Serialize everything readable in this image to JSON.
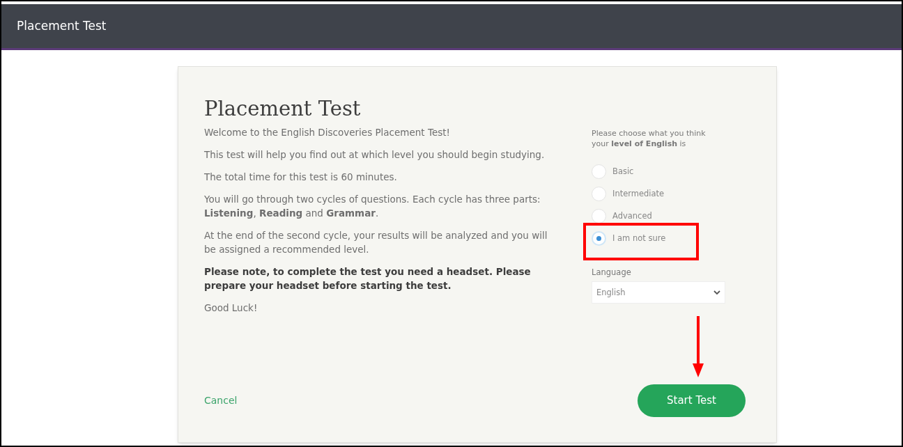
{
  "header": {
    "title": "Placement Test"
  },
  "card": {
    "title": "Placement Test",
    "paragraphs": [
      {
        "kind": "text",
        "text": "Welcome to the English Discoveries Placement Test!"
      },
      {
        "kind": "text",
        "text": "This test will help you find out at which level you should begin studying."
      },
      {
        "kind": "text",
        "text": "The total time for this test is 60 minutes."
      },
      {
        "kind": "text",
        "text": "You will go through two cycles of questions. Each cycle has three parts: **Listening**, **Reading** and **Grammar**."
      },
      {
        "kind": "text",
        "text": "At the end of the second cycle, your results will be analyzed and you will be assigned a recommended level."
      },
      {
        "kind": "note",
        "text": "Please note, to complete the test you need a headset. Please prepare your headset before starting the test."
      },
      {
        "kind": "text",
        "text": "Good Luck!"
      }
    ],
    "level_prompt": "Please choose what you think your **level of English** is",
    "levels": [
      {
        "label": "Basic",
        "selected": false
      },
      {
        "label": "Intermediate",
        "selected": false
      },
      {
        "label": "Advanced",
        "selected": false
      },
      {
        "label": "I am not sure",
        "selected": true
      }
    ],
    "language": {
      "label": "Language",
      "value": "English"
    },
    "cancel": "Cancel",
    "start": "Start Test"
  }
}
